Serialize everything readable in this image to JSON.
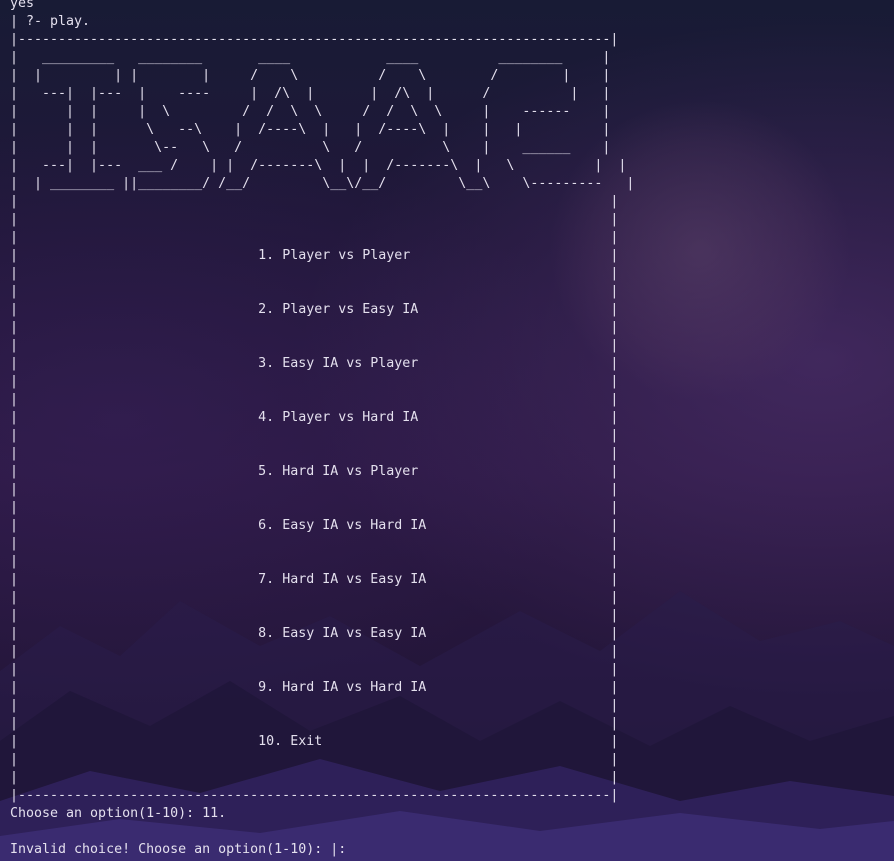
{
  "terminal": {
    "header_line": "yes",
    "prompt_line": "| ?- play.",
    "banner": [
      "|--------------------------------------------------------------------------|",
      "|   _________   ________       ____            ____          ________     |",
      "|  |         | |        |     /    \\          /    \\        /        |    |",
      "|   ---|  |---  |    ----     |  /\\  |       |  /\\  |      /          |   |",
      "|      |  |     |  \\         /  /  \\  \\     /  /  \\  \\     |    ------    |",
      "|      |  |      \\   --\\    |  /----\\  |   |  /----\\  |    |   |          |",
      "|      |  |       \\--   \\   /          \\   /          \\    |    ______    |",
      "|   ---|  |---  ___ /    | |  /-------\\  |  |  /-------\\  |   \\          |  |",
      "|  | ________ ||________/ /__/         \\__\\/__/         \\__\\    \\---------   |"
    ],
    "menu": [
      "1. Player vs Player",
      "2. Player vs Easy IA",
      "3. Easy IA vs Player",
      "4. Player vs Hard IA",
      "5. Hard IA vs Player",
      "6. Easy IA vs Hard IA",
      "7. Hard IA vs Easy IA",
      "8. Easy IA vs Easy IA",
      "9. Hard IA vs Hard IA",
      "10. Exit"
    ],
    "border_line": "|--------------------------------------------------------------------------|",
    "choose_line": "Choose an option(1-10): 11.",
    "invalid_line": "Invalid choice! Choose an option(1-10): |: "
  }
}
